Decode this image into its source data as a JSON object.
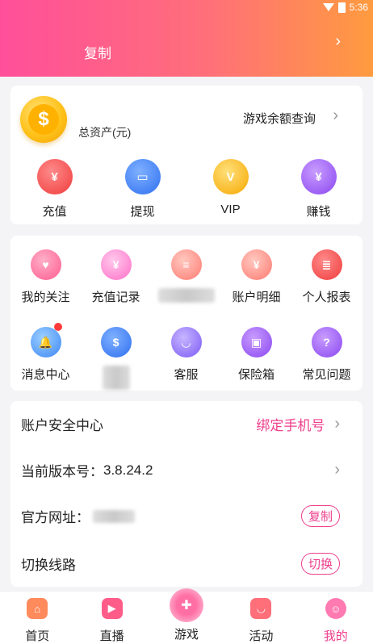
{
  "status": {
    "time": "5:36"
  },
  "header": {
    "copy_label": "复制",
    "chevron": "›"
  },
  "assets": {
    "coin_glyph": "$",
    "label": "总资产(元)",
    "balance_link": "游戏余额查询",
    "chevron": "›"
  },
  "quick_actions": [
    {
      "label": "充值",
      "icon": "money-bag-icon",
      "glyph": "¥"
    },
    {
      "label": "提现",
      "icon": "card-icon",
      "glyph": "▭"
    },
    {
      "label": "VIP",
      "icon": "vip-icon",
      "glyph": "V"
    },
    {
      "label": "赚钱",
      "icon": "earn-icon",
      "glyph": "¥"
    }
  ],
  "grid_row1": [
    {
      "label": "我的关注",
      "icon": "heart-icon",
      "glyph": "♥"
    },
    {
      "label": "充值记录",
      "icon": "recharge-record-icon",
      "glyph": "¥"
    },
    {
      "label": "",
      "icon": "document-icon",
      "glyph": "≡"
    },
    {
      "label": "账户明细",
      "icon": "account-detail-icon",
      "glyph": "¥"
    },
    {
      "label": "个人报表",
      "icon": "report-icon",
      "glyph": "≣"
    }
  ],
  "grid_row2": [
    {
      "label": "消息中心",
      "icon": "bell-icon",
      "glyph": "🔔"
    },
    {
      "label": "",
      "icon": "chip-icon",
      "glyph": "$"
    },
    {
      "label": "客服",
      "icon": "headset-icon",
      "glyph": "◡"
    },
    {
      "label": "保险箱",
      "icon": "safe-icon",
      "glyph": "▣"
    },
    {
      "label": "常见问题",
      "icon": "question-icon",
      "glyph": "?"
    }
  ],
  "settings": {
    "security_label": "账户安全中心",
    "bind_phone": "绑定手机号",
    "version_label": "当前版本号：",
    "version_value": "3.8.24.2",
    "website_label": "官方网址：",
    "copy_button": "复制",
    "switch_label": "切换线路",
    "switch_button": "切换",
    "chevron": "›"
  },
  "tabbar": [
    {
      "label": "首页",
      "icon": "home-icon",
      "glyph": "⌂",
      "color": "#ff8a5c"
    },
    {
      "label": "直播",
      "icon": "live-icon",
      "glyph": "▶",
      "color": "#ff5c8a"
    },
    {
      "label": "游戏",
      "icon": "gamepad-icon",
      "glyph": "✚",
      "color": "#ff5c8a"
    },
    {
      "label": "活动",
      "icon": "activity-icon",
      "glyph": "◡",
      "color": "#ff6f7a"
    },
    {
      "label": "我的",
      "icon": "profile-icon",
      "glyph": "☺",
      "color": "#ff7ab0"
    }
  ],
  "colors": {
    "accent": "#ef3f8c",
    "header_start": "#ff4f9a",
    "header_end": "#ff9b3f"
  }
}
